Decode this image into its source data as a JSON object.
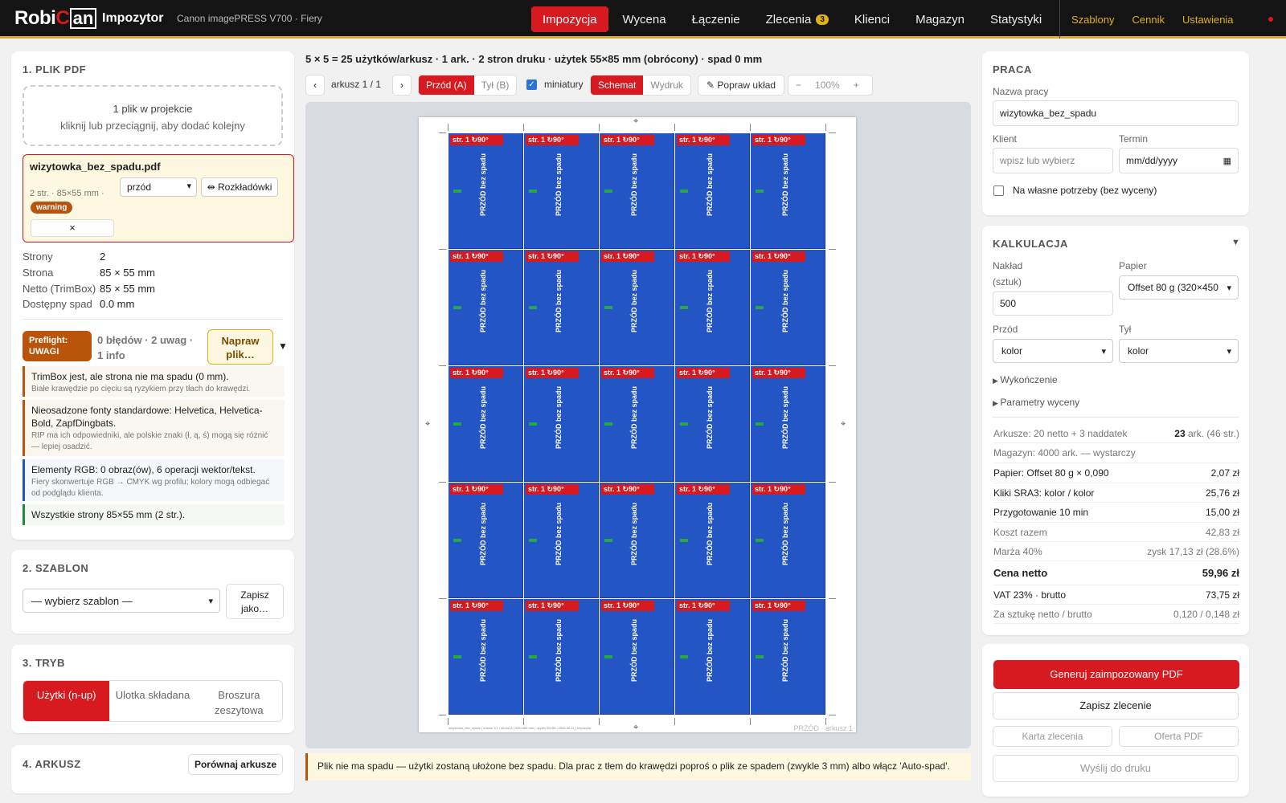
{
  "header": {
    "logo_part1": "Robi",
    "logo_part2": "C",
    "logo_part3": "an",
    "app_name": "Impozytor",
    "device": "Canon imagePRESS V700 · Fiery",
    "nav": [
      {
        "label": "Impozycja"
      },
      {
        "label": "Wycena"
      },
      {
        "label": "Łączenie"
      },
      {
        "label": "Zlecenia",
        "badge": "3"
      },
      {
        "label": "Klienci"
      },
      {
        "label": "Magazyn"
      },
      {
        "label": "Statystyki"
      }
    ],
    "secondary": [
      "Szablony",
      "Cennik",
      "Ustawienia"
    ]
  },
  "pdf": {
    "title": "1. PLIK PDF",
    "drop_line1": "1 plik w projekcie",
    "drop_line2": "kliknij lub przeciągnij, aby dodać kolejny",
    "file_name": "wizytowka_bez_spadu.pdf",
    "file_meta": "2 str. · 85×55 mm ·",
    "file_badge": "warning",
    "side_select": "przód",
    "spread_btn": "⇹ Rozkładówki",
    "remove": "×",
    "props": [
      {
        "k": "Strony",
        "v": "2"
      },
      {
        "k": "Strona",
        "v": "85 × 55 mm"
      },
      {
        "k": "Netto (TrimBox)",
        "v": "85 × 55 mm"
      },
      {
        "k": "Dostępny spad",
        "v": "0.0 mm"
      }
    ],
    "preflight_badge": "Preflight: UWAGI",
    "preflight_summary": "0 błędów · 2 uwag · 1 info",
    "fix_btn": "Napraw plik…",
    "messages": [
      {
        "t": "TrimBox jest, ale strona nie ma spadu (0 mm).",
        "d": "Białe krawędzie po cięciu są ryzykiem przy tłach do krawędzi."
      },
      {
        "t": "Nieosadzone fonty standardowe: Helvetica, Helvetica-Bold, ZapfDingbats.",
        "d": "RIP ma ich odpowiedniki, ale polskie znaki (ł, ą, ś) mogą się różnić — lepiej osadzić."
      },
      {
        "t": "Elementy RGB: 0 obraz(ów), 6 operacji wektor/tekst.",
        "d": "Fiery skonwertuje RGB → CMYK wg profilu; kolory mogą odbiegać od podglądu klienta."
      },
      {
        "t": "Wszystkie strony 85×55 mm (2 str.).",
        "d": ""
      }
    ]
  },
  "template": {
    "title": "2. SZABLON",
    "select": "— wybierz szablon —",
    "save_as": "Zapisz jako…"
  },
  "mode": {
    "title": "3. TRYB",
    "options": [
      "Użytki (n-up)",
      "Ulotka składana",
      "Broszura zeszytowa"
    ],
    "active": 0
  },
  "sheet_section": {
    "title": "4. ARKUSZ",
    "compare": "Porównaj arkusze"
  },
  "preview": {
    "info": "5 × 5 = 25 użytków/arkusz · 1 ark. · 2 stron druku · użytek 55×85 mm (obrócony) · spad 0 mm",
    "prev": "‹",
    "next": "›",
    "sheet_counter": "arkusz 1 / 1",
    "front": "Przód (A)",
    "back": "Tył (B)",
    "thumbs_label": "miniatury",
    "view_schema": "Schemat",
    "view_print": "Wydruk",
    "fix_layout": "✎ Popraw układ",
    "zoom_minus": "−",
    "zoom": "100%",
    "zoom_plus": "+",
    "cols": 5,
    "rows": 5,
    "cell_label": "str. 1 ↻90°",
    "cell_text": "PRZÓD bez spadu",
    "footer_small": "wizytowka_bez_spadu | arkusz 1/1 | strona A | 320×450 mm | użytek 55×85 | 2026-05-11 | Impozytor",
    "sheet_label": "PRZÓD · arkusz 1",
    "notice": "Plik nie ma spadu — użytki zostaną ułożone bez spadu. Dla prac z tłem do krawędzi poproś o plik ze spadem (zwykle 3 mm) albo włącz 'Auto-spad'."
  },
  "job": {
    "title": "PRACA",
    "name_label": "Nazwa pracy",
    "name_value": "wizytowka_bez_spadu",
    "client_label": "Klient",
    "client_placeholder": "wpisz lub wybierz",
    "due_label": "Termin",
    "due_placeholder": "mm/dd/yyyy",
    "own_needs": "Na własne potrzeby (bez wyceny)"
  },
  "calc": {
    "title": "KALKULACJA",
    "qty_label1": "Nakład",
    "qty_label2": "(sztuk)",
    "qty": "500",
    "paper_label": "Papier",
    "paper": "Offset 80 g (320×450",
    "front_label": "Przód",
    "front": "kolor",
    "back_label": "Tył",
    "back": "kolor",
    "finishing": "Wykończenie",
    "pricing_params": "Parametry wyceny",
    "rows": [
      {
        "l": "Arkusze: 20 netto + 3 naddatek",
        "r": "23 ark. (46 str.)",
        "muted": true
      },
      {
        "l": "Magazyn: 4000 ark. — wystarczy",
        "r": "",
        "muted": true
      },
      {
        "l": "Papier: Offset 80 g × 0,090",
        "r": "2,07 zł"
      },
      {
        "l": "Kliki SRA3: kolor / kolor",
        "r": "25,76 zł"
      },
      {
        "l": "Przygotowanie 10 min",
        "r": "15,00 zł"
      },
      {
        "l": "Koszt razem",
        "r": "42,83 zł",
        "muted": true
      },
      {
        "l": "Marża 40%",
        "r": "zysk 17,13 zł (28.6%)",
        "muted": true
      },
      {
        "l": "Cena netto",
        "r": "59,96 zł",
        "bold": true
      },
      {
        "l": "VAT 23% · brutto",
        "r": "73,75 zł"
      },
      {
        "l": "Za sztukę netto / brutto",
        "r": "0,120 / 0,148 zł",
        "muted": true
      }
    ]
  },
  "actions": {
    "generate": "Generuj zaimpozowany PDF",
    "save_order": "Zapisz zlecenie",
    "order_card": "Karta zlecenia",
    "offer_pdf": "Oferta PDF",
    "send_print": "Wyślij do druku"
  },
  "colors": {
    "accent": "#d71920",
    "gold": "#e0b11c",
    "cell_blue": "#2356c4",
    "warning": "#b8540c"
  }
}
